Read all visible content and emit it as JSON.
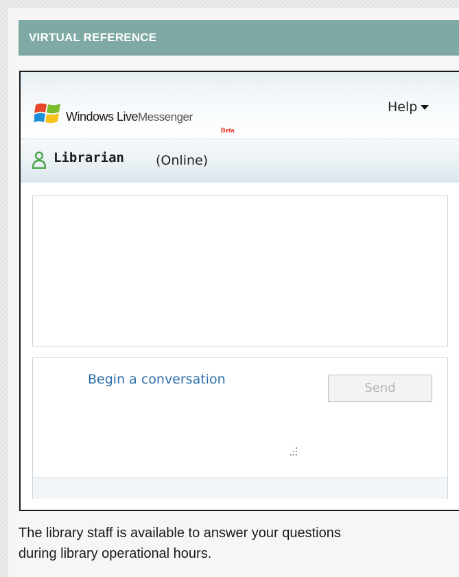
{
  "section": {
    "title": "VIRTUAL REFERENCE"
  },
  "messenger": {
    "logo_text_bold": "Windows Live",
    "logo_text_light": "Messenger",
    "beta_label": "Beta",
    "help_label": "Help",
    "contact": {
      "name": "Librarian",
      "status": "(Online)"
    },
    "compose": {
      "placeholder": "Begin a conversation",
      "send_label": "Send"
    }
  },
  "note": {
    "line1": "The library staff is available to answer your questions",
    "line2": "during library operational hours."
  },
  "colors": {
    "header_bg": "#7fa9a4",
    "link_blue": "#2a6ea8",
    "beta_red": "#e0261a",
    "online_green": "#4aa84a"
  },
  "icons": [
    "windows-flag-icon",
    "help-caret-icon",
    "online-person-icon",
    "resize-grip-icon"
  ]
}
